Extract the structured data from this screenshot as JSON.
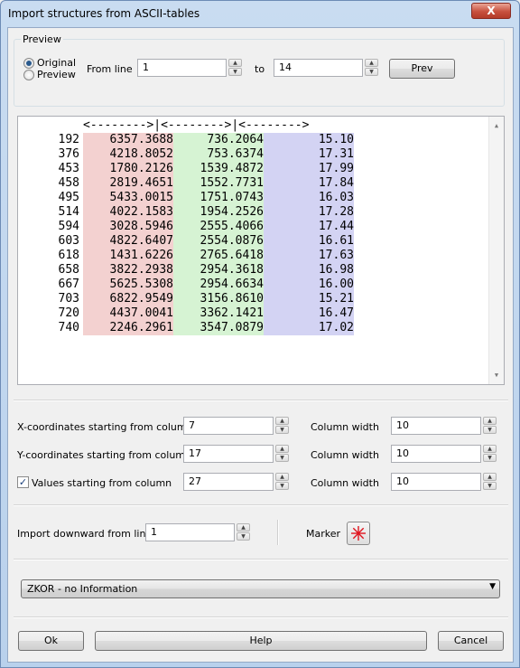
{
  "window": {
    "title": "Import structures from ASCII-tables",
    "close_label": "X"
  },
  "preview_group": {
    "title": "Preview",
    "radio_original": "Original",
    "radio_preview": "Preview",
    "from_line_label": "From line",
    "from_line_value": "1",
    "to_label": "to",
    "to_value": "14",
    "prev_button": "Prev"
  },
  "preview_text": {
    "header": "<-------->|<-------->|<-------->",
    "rows": [
      [
        "192",
        "6357.3688",
        "736.2064",
        "15.10"
      ],
      [
        "376",
        "4218.8052",
        "753.6374",
        "17.31"
      ],
      [
        "453",
        "1780.2126",
        "1539.4872",
        "17.99"
      ],
      [
        "458",
        "2819.4651",
        "1552.7731",
        "17.84"
      ],
      [
        "495",
        "5433.0015",
        "1751.0743",
        "16.03"
      ],
      [
        "514",
        "4022.1583",
        "1954.2526",
        "17.28"
      ],
      [
        "594",
        "3028.5946",
        "2555.4066",
        "17.44"
      ],
      [
        "603",
        "4822.6407",
        "2554.0876",
        "16.61"
      ],
      [
        "618",
        "1431.6226",
        "2765.6418",
        "17.63"
      ],
      [
        "658",
        "3822.2938",
        "2954.3618",
        "16.98"
      ],
      [
        "667",
        "5625.5308",
        "2954.6634",
        "16.00"
      ],
      [
        "703",
        "6822.9549",
        "3156.8610",
        "15.21"
      ],
      [
        "720",
        "4437.0041",
        "3362.1421",
        "16.47"
      ],
      [
        "740",
        "2246.2961",
        "3547.0879",
        "17.02"
      ]
    ],
    "colors": {
      "x": "#f3d1d0",
      "y": "#d6f3d3",
      "value": "#d3d3f3"
    }
  },
  "columns": {
    "x_label": "X-coordinates starting from column",
    "x_value": "7",
    "y_label": "Y-coordinates starting from column",
    "y_value": "17",
    "values_label": "Values starting from column",
    "values_value": "27",
    "values_checked": true,
    "width_label": "Column width",
    "x_width": "10",
    "y_width": "10",
    "values_width": "10"
  },
  "import": {
    "label": "Import downward from line",
    "value": "1",
    "marker_label": "Marker",
    "marker_icon": "red-asterisk",
    "marker_color": "#e0141e"
  },
  "combo": {
    "selected": "ZKOR - no Information"
  },
  "buttons": {
    "ok": "Ok",
    "help": "Help",
    "cancel": "Cancel"
  }
}
